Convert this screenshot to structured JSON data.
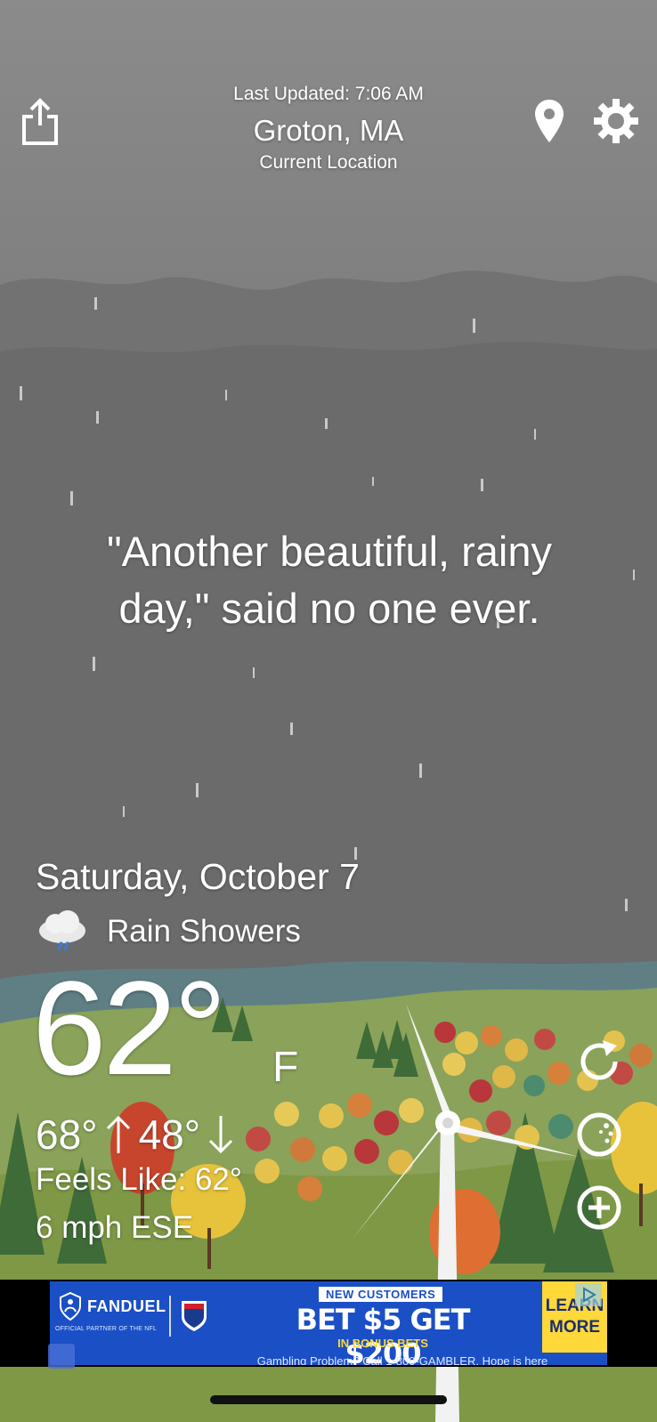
{
  "header": {
    "last_updated": "Last Updated: 7:06 AM",
    "city": "Groton, MA",
    "location_label": "Current Location"
  },
  "quote": "\"Another beautiful, rainy day,\" said no one ever.",
  "forecast": {
    "date": "Saturday, October 7",
    "condition": "Rain Showers",
    "temperature": "62°",
    "unit": "F",
    "high": "68°",
    "low": "48°",
    "feels_like": "Feels Like: 62°",
    "wind": "6 mph ESE"
  },
  "ad": {
    "brand": "FANDUEL",
    "partner": "OFFICIAL PARTNER OF THE NFL",
    "badge": "NEW CUSTOMERS",
    "headline": "BET $5 GET $200",
    "sub": "IN BONUS BETS",
    "cta_line1": "LEARN",
    "cta_line2": "MORE",
    "disclaimer": "Gambling Problem? Call 1-800-GAMBLER. Hope is here"
  },
  "icons": {
    "share": "share-icon",
    "location": "location-pin-icon",
    "settings": "gear-icon",
    "refresh": "refresh-icon",
    "radar": "radar-icon",
    "add": "add-icon",
    "weather": "rain-cloud-icon"
  },
  "colors": {
    "sky": "#6e6e6e",
    "ad_blue": "#1a4fc6",
    "ad_yellow": "#ffd83a"
  }
}
